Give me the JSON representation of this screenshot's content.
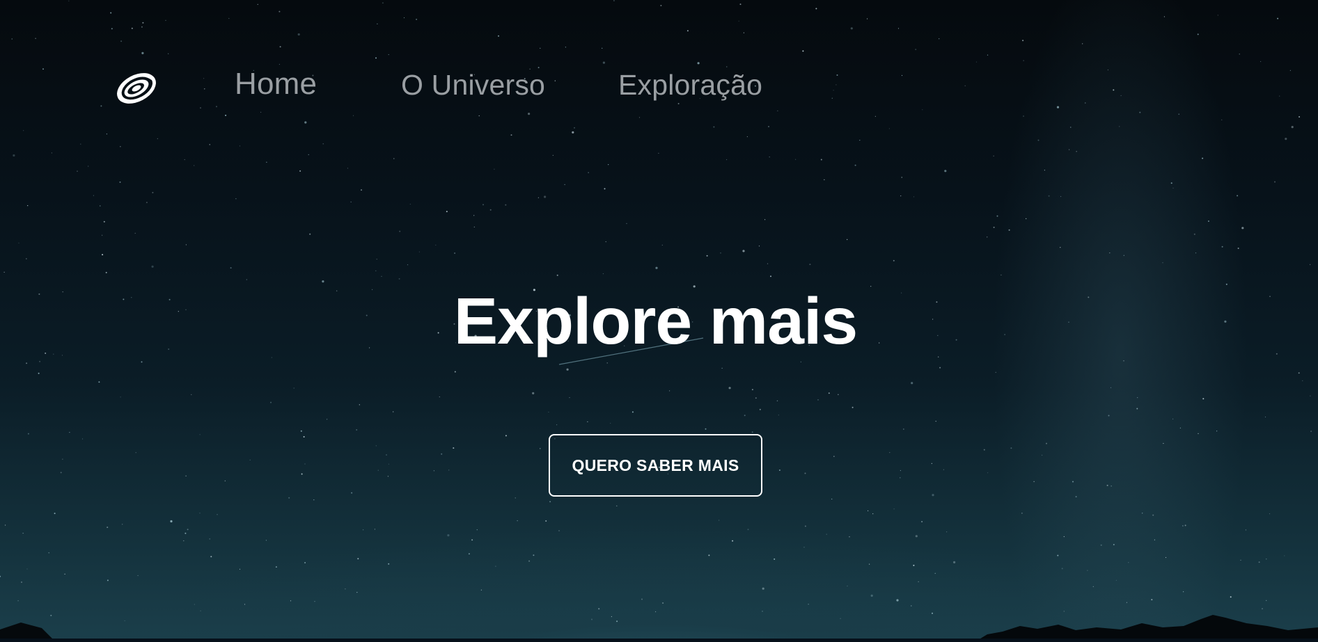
{
  "nav": {
    "logo_icon": "spiral-galaxy-icon",
    "links": [
      {
        "label": "Home"
      },
      {
        "label": "O Universo"
      },
      {
        "label": "Exploração"
      }
    ]
  },
  "hero": {
    "headline": "Explore mais",
    "cta_label": "QUERO SABER MAIS",
    "background": "starry night sky"
  },
  "colors": {
    "nav_link": "#9a9fa3",
    "headline": "#ffffff",
    "cta_border": "#ffffff",
    "sky_top": "#050a0e",
    "sky_bottom": "#1b3f4b"
  }
}
